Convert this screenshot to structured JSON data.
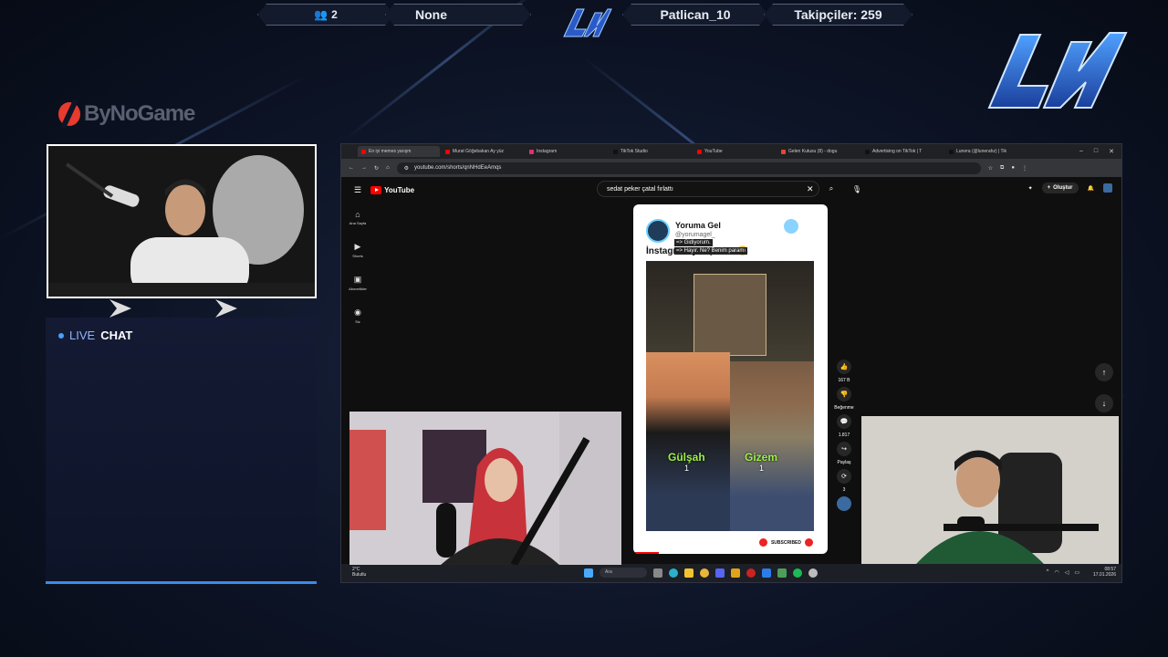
{
  "overlay": {
    "viewers": "2",
    "game": "None",
    "username": "Patlican_10",
    "followers": "Takipçiler: 259",
    "sponsor": "ByNoGame",
    "chat_live": "LIVE",
    "chat_label": "CHAT",
    "accent_color": "#3a8be8"
  },
  "browser": {
    "tabs": [
      {
        "label": "En iyi memes yarışm",
        "color": "#ff0000",
        "active": true
      },
      {
        "label": "Murat Göğebakan Ay yüz",
        "color": "#ff0000"
      },
      {
        "label": "Instagram",
        "color": "#e1306c"
      },
      {
        "label": "TikTok Studio",
        "color": "#111111"
      },
      {
        "label": "YouTube",
        "color": "#ff0000"
      },
      {
        "label": "Gelen Kutusu (8) - dogu",
        "color": "#ea4335"
      },
      {
        "label": "Advertising on TikTok | T",
        "color": "#111111"
      },
      {
        "label": "Lunera (@lunerahz) | Tik",
        "color": "#111111"
      }
    ],
    "url": "youtube.com/shorts/qnNHdEeAmqs"
  },
  "youtube": {
    "logo": "YouTube",
    "search_value": "sedat peker çatal fırlattı",
    "create_label": "Oluştur",
    "sidebar": [
      {
        "icon": "home-icon",
        "glyph": "⌂",
        "label": "Ana Sayfa"
      },
      {
        "icon": "shorts-icon",
        "glyph": "▶",
        "label": "Shorts"
      },
      {
        "icon": "subscriptions-icon",
        "glyph": "▣",
        "label": "Abonelikler"
      },
      {
        "icon": "you-icon",
        "glyph": "◉",
        "label": "Siz"
      }
    ],
    "short": {
      "channel": "Yoruma Gel",
      "handle": "@yorumagel_",
      "caption": "İnstagram yarışması 😂",
      "tip1": "=> Gidiyorum.",
      "tip2": "=> Hayır. Ne? Benim paramı",
      "name_left": "Gülşah",
      "name_right": "Gizem",
      "num_left": "1",
      "num_right": "1",
      "subscribed": "SUBSCRIBED"
    },
    "actions": {
      "likes": "167 B",
      "dislike": "Beğenme",
      "comments": "1.817",
      "share": "Paylaş",
      "remix": "3"
    }
  },
  "taskbar": {
    "temp": "2°C",
    "weather": "Bulutlu",
    "search": "Ara",
    "time": "08:57",
    "date": "17.01.2026"
  }
}
